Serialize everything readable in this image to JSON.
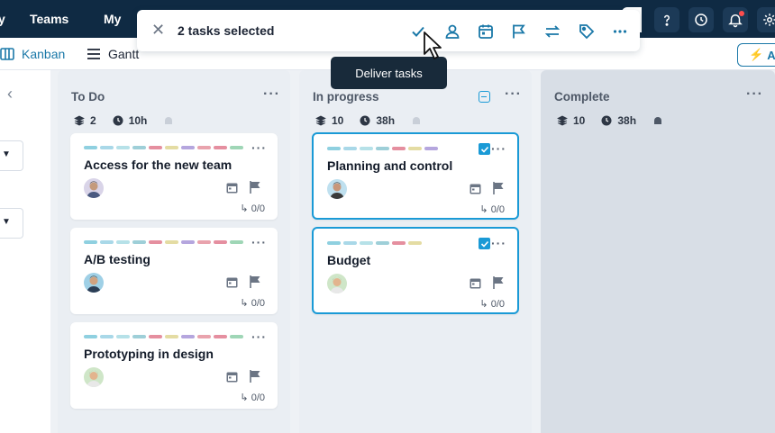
{
  "nav": {
    "partial_item": "y",
    "teams": "Teams",
    "my": "My",
    "icons": [
      "help-icon",
      "history-icon",
      "bell-icon",
      "settings-icon"
    ]
  },
  "views": {
    "kanban": "Kanban",
    "gantt": "Gantt",
    "auto_button": "A"
  },
  "bulk_bar": {
    "label": "2 tasks selected",
    "actions": [
      "check-icon",
      "assign-user-icon",
      "calendar-icon",
      "flag-icon",
      "move-icon",
      "tag-icon",
      "more-icon"
    ]
  },
  "tooltip": "Deliver tasks",
  "columns": [
    {
      "title": "To Do",
      "tasks_count": "2",
      "hours": "10h",
      "cards": [
        {
          "title": "Access for the new team",
          "subtasks": "0/0",
          "selected": false
        },
        {
          "title": "A/B testing",
          "subtasks": "0/0",
          "selected": false
        },
        {
          "title": "Prototyping in design",
          "subtasks": "0/0",
          "selected": false
        }
      ]
    },
    {
      "title": "In progress",
      "tasks_count": "10",
      "hours": "38h",
      "cards": [
        {
          "title": "Planning and control",
          "subtasks": "0/0",
          "selected": true
        },
        {
          "title": "Budget",
          "subtasks": "0/0",
          "selected": true
        }
      ]
    },
    {
      "title": "Complete",
      "tasks_count": "10",
      "hours": "38h",
      "cards": []
    }
  ],
  "colors": {
    "nav_bg": "#0f2a43",
    "accent": "#1a9ad6",
    "tag_colors": [
      "#8fd0e0",
      "#a9d8e8",
      "#b6e1e8",
      "#9ecfd8",
      "#e58f9f",
      "#e4dca3",
      "#b5a6de",
      "#e9a3ad",
      "#e58fa0",
      "#9fd6b6"
    ]
  }
}
